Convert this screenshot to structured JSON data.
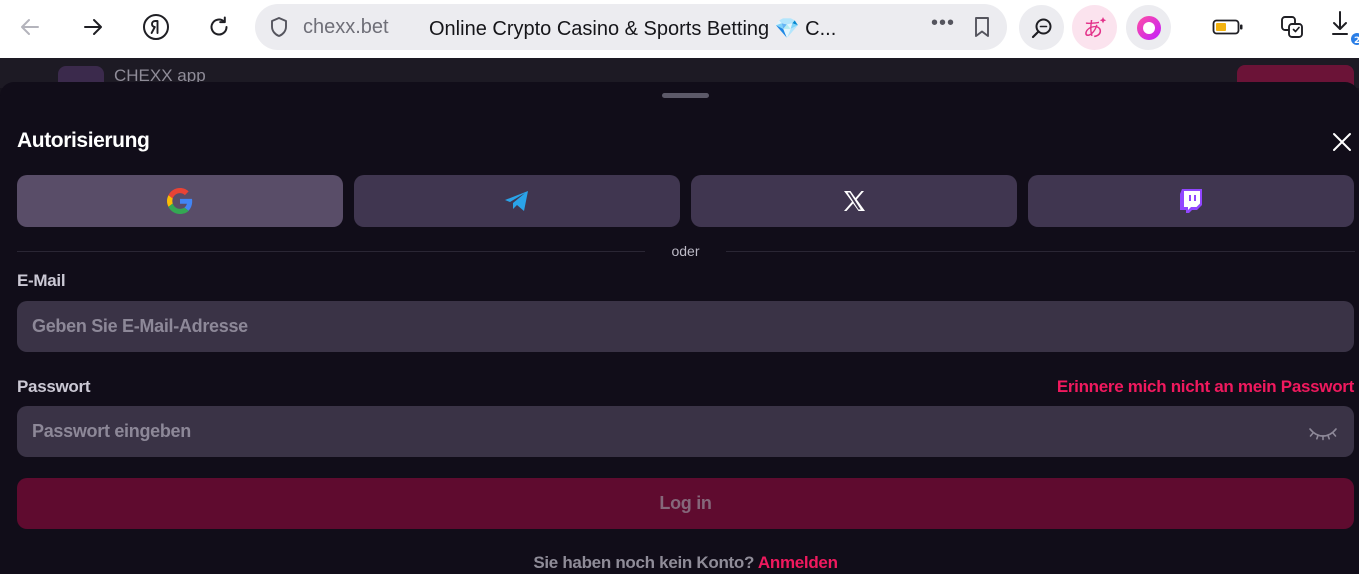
{
  "browser": {
    "domain": "chexx.bet",
    "page_title": "Online Crypto Casino & Sports Betting 💎 C...",
    "more_label": "•••",
    "badge_count": "2"
  },
  "background_page": {
    "app_name": "CHEXX app"
  },
  "auth": {
    "title": "Autorisierung",
    "social_providers": [
      "google-icon",
      "telegram-icon",
      "x-icon",
      "twitch-icon"
    ],
    "divider_text": "oder",
    "email": {
      "label": "E-Mail",
      "placeholder": "Geben Sie E-Mail-Adresse",
      "value": ""
    },
    "password": {
      "label": "Passwort",
      "placeholder": "Passwort eingeben",
      "value": "",
      "forgot_label": "Erinnere mich nicht an mein Passwort"
    },
    "login_label": "Log in",
    "no_account_text": "Sie haben noch kein Konto?",
    "signup_label": "Anmelden"
  },
  "colors": {
    "accent": "#f0195e",
    "login_button_bg": "#5f0b2f",
    "sheet_bg": "#110d19",
    "input_bg": "#3a3346"
  }
}
